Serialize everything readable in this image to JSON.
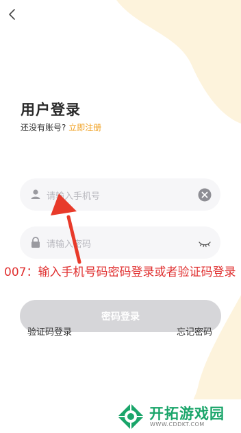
{
  "header": {
    "back_icon": "chevron-left-icon"
  },
  "login": {
    "title": "用户登录",
    "no_account_text": "还没有账号?",
    "register_link": "立即注册",
    "phone_field": {
      "placeholder": "请输入手机号",
      "lead_icon": "user-icon",
      "trail_icon": "clear-icon"
    },
    "password_field": {
      "placeholder": "请输入密码",
      "lead_icon": "lock-icon",
      "trail_icon": "eye-closed-icon"
    },
    "submit_label": "密码登录",
    "sms_login_link": "验证码登录",
    "forgot_link": "忘记密码"
  },
  "annotation": {
    "text": "007：输入手机号码密码登录或者验证码登录",
    "color": "#e03030"
  },
  "watermark": {
    "name": "开拓游戏园",
    "url": "WWW.CDDKT.COM"
  },
  "colors": {
    "accent": "#f0a020",
    "button_disabled": "#d6d6d9",
    "field_bg": "#f6f6f8",
    "blob": "#fdf3dc"
  }
}
